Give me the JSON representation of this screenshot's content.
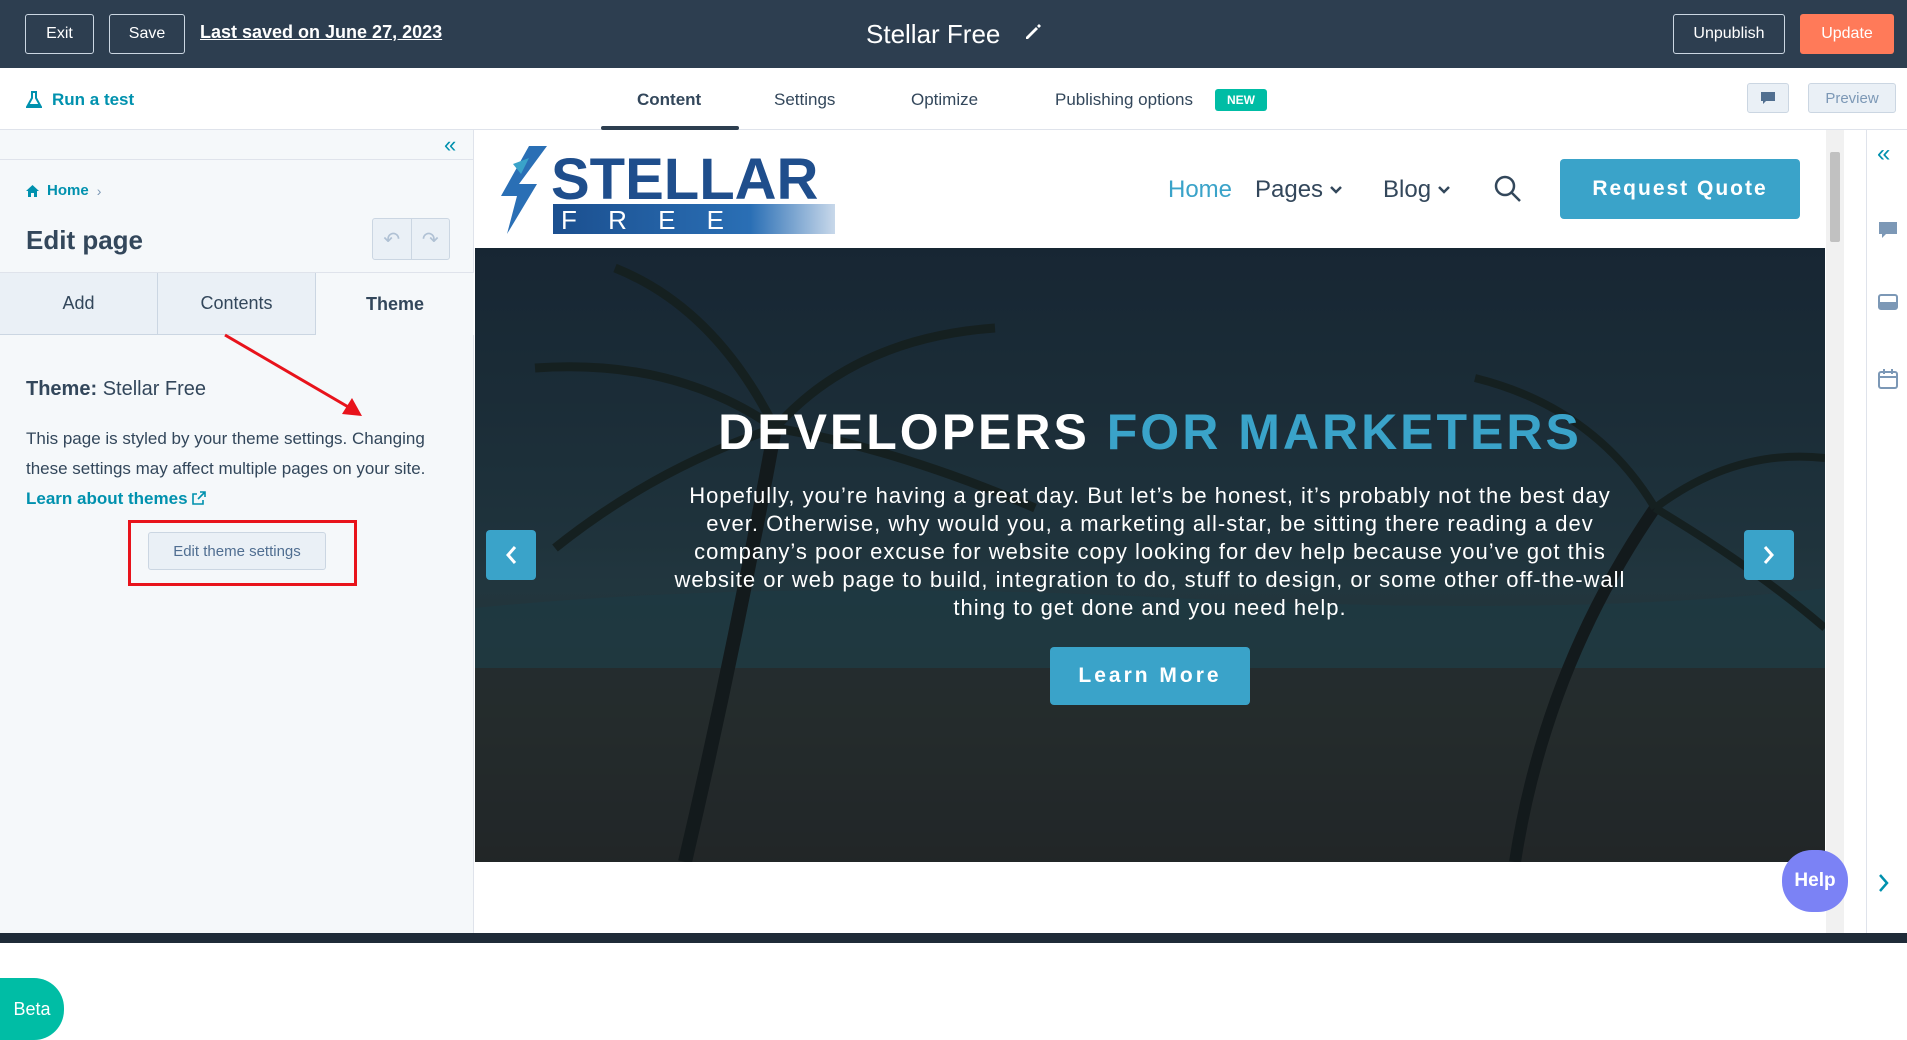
{
  "topbar": {
    "exit_label": "Exit",
    "save_label": "Save",
    "last_saved": "Last saved on June 27, 2023",
    "page_name": "Stellar Free",
    "unpublish_label": "Unpublish",
    "update_label": "Update"
  },
  "subbar": {
    "run_test": "Run a test",
    "tabs": [
      {
        "label": "Content"
      },
      {
        "label": "Settings"
      },
      {
        "label": "Optimize"
      },
      {
        "label": "Publishing options"
      }
    ],
    "new_badge": "NEW",
    "preview_label": "Preview"
  },
  "sidebar": {
    "breadcrumb": "Home",
    "title": "Edit page",
    "tabs": [
      {
        "label": "Add"
      },
      {
        "label": "Contents"
      },
      {
        "label": "Theme"
      }
    ],
    "theme_label": "Theme:",
    "theme_name": "Stellar Free",
    "theme_desc": "This page is styled by your theme settings. Changing these settings may affect multiple pages on your site.",
    "learn_link": "Learn about themes",
    "edit_theme_button": "Edit theme settings",
    "beta_label": "Beta"
  },
  "preview": {
    "logo_top": "STELLAR",
    "logo_bottom": "F R E E",
    "nav": [
      {
        "label": "Home"
      },
      {
        "label": "Pages"
      },
      {
        "label": "Blog"
      }
    ],
    "quote_button": "Request Quote",
    "hero_title_1": "DEVELOPERS",
    "hero_title_2": "FOR MARKETERS",
    "hero_text": "Hopefully, you’re having a great day. But let’s be honest, it’s probably not the best day ever. Otherwise, why would you, a marketing all-star, be sitting there reading a dev company’s poor excuse for website copy looking for dev help because you’ve got this website or web page to build, integration to do, stuff to design, or some other off-the-wall thing to get done and you need help.",
    "learn_more": "Learn More"
  },
  "help_label": "Help",
  "colors": {
    "topbar": "#2d3e50",
    "accent": "#3aa3c9",
    "update": "#ff7a59",
    "annotation": "#e8131b"
  }
}
